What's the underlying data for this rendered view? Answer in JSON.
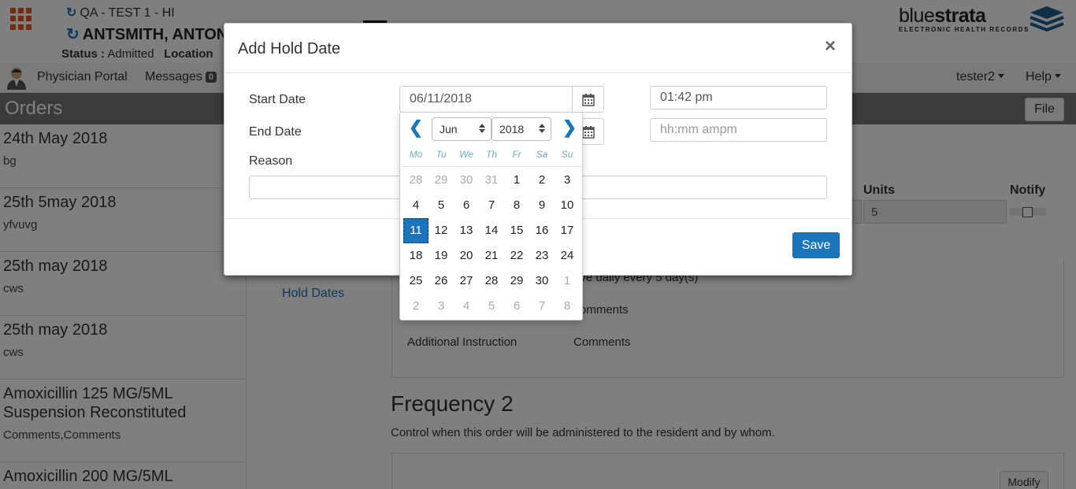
{
  "header": {
    "facility": "QA - TEST 1 - HI",
    "patient_name": "ANTSMITH, ANTON",
    "status_label": "Status :",
    "status_value": "Admitted",
    "location_label": "Location",
    "logo_text_1": "blue",
    "logo_text_2": "strata",
    "logo_tagline": "ELECTRONIC HEALTH RECORDS"
  },
  "nav": {
    "physician_portal": "Physician Portal",
    "messages": "Messages",
    "messages_count": "0",
    "user": "tester2",
    "help": "Help"
  },
  "orders": {
    "title": "Orders",
    "file_button": "File",
    "items": [
      {
        "title": "24th May 2018",
        "detail": "bg"
      },
      {
        "title": "25th 5may 2018",
        "detail": "yfvuvg"
      },
      {
        "title": "25th may 2018",
        "detail": "cws"
      },
      {
        "title": "25th may 2018",
        "detail": "cws"
      },
      {
        "title": "Amoxicillin 125 MG/5ML Suspension Reconstituted",
        "detail": "Comments,Comments"
      },
      {
        "title": "Amoxicillin 200 MG/5ML",
        "detail": ""
      }
    ]
  },
  "main": {
    "hold_dates_link": "Hold Dates",
    "units_label": "Units",
    "units_value": "5",
    "notify_label": "Notify",
    "freq_line": "ive daily every 5 day(s)",
    "comments_1": "omments",
    "additional_instruction": "Additional Instruction",
    "comments_2": "Comments",
    "frequency2_title": "Frequency 2",
    "frequency2_desc": "Control when this order will be administered to the resident and by whom.",
    "modify_button": "Modify"
  },
  "modal": {
    "title": "Add Hold Date",
    "close": "×",
    "start_date_label": "Start Date",
    "start_date_value": "06/11/2018",
    "start_time_value": "01:42 pm",
    "end_date_label": "End Date",
    "end_time_placeholder": "hh:mm ampm",
    "reason_label": "Reason",
    "reason_value": "",
    "save_button": "Save"
  },
  "datepicker": {
    "prev": "❮",
    "next": "❯",
    "month": "Jun",
    "year": "2018",
    "weekdays": [
      "Mo",
      "Tu",
      "We",
      "Th",
      "Fr",
      "Sa",
      "Su"
    ],
    "selected_day": "11",
    "weeks": [
      [
        "28",
        "29",
        "30",
        "31",
        "1",
        "2",
        "3"
      ],
      [
        "4",
        "5",
        "6",
        "7",
        "8",
        "9",
        "10"
      ],
      [
        "11",
        "12",
        "13",
        "14",
        "15",
        "16",
        "17"
      ],
      [
        "18",
        "19",
        "20",
        "21",
        "22",
        "23",
        "24"
      ],
      [
        "25",
        "26",
        "27",
        "28",
        "29",
        "30",
        "1"
      ],
      [
        "2",
        "3",
        "4",
        "5",
        "6",
        "7",
        "8"
      ]
    ],
    "outside_month": [
      [
        true,
        true,
        true,
        true,
        false,
        false,
        false
      ],
      [
        false,
        false,
        false,
        false,
        false,
        false,
        false
      ],
      [
        false,
        false,
        false,
        false,
        false,
        false,
        false
      ],
      [
        false,
        false,
        false,
        false,
        false,
        false,
        false
      ],
      [
        false,
        false,
        false,
        false,
        false,
        false,
        true
      ],
      [
        true,
        true,
        true,
        true,
        true,
        true,
        true
      ]
    ]
  },
  "colors": {
    "accent": "#1b75bb",
    "grid_icon": "#e8541b"
  }
}
